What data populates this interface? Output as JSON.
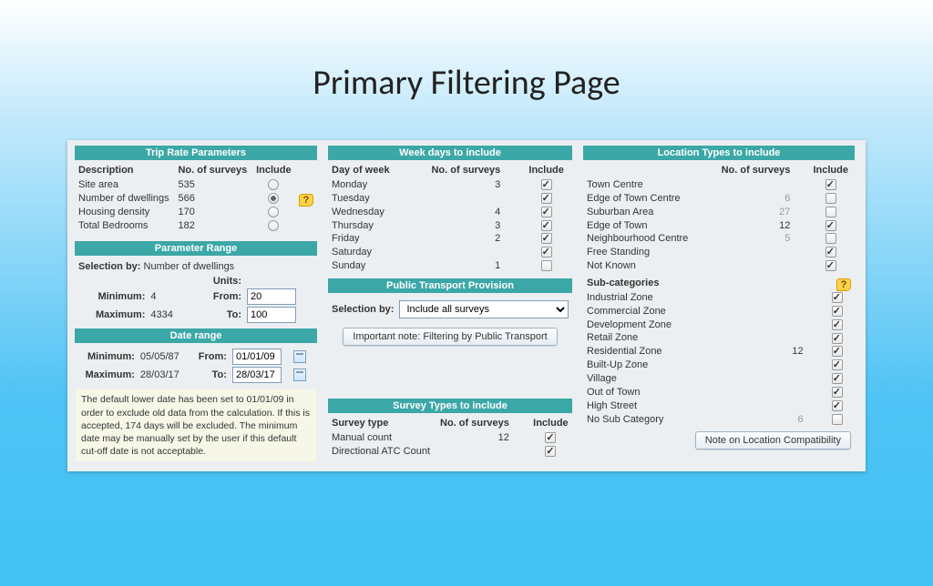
{
  "page_title": "Primary Filtering Page",
  "trip_rate": {
    "header": "Trip Rate Parameters",
    "columns": [
      "Description",
      "No. of surveys",
      "Include"
    ],
    "rows": [
      {
        "desc": "Site area",
        "n": "535",
        "selected": false
      },
      {
        "desc": "Number of dwellings",
        "n": "566",
        "selected": true
      },
      {
        "desc": "Housing density",
        "n": "170",
        "selected": false
      },
      {
        "desc": "Total Bedrooms",
        "n": "182",
        "selected": false
      }
    ]
  },
  "param_range": {
    "header": "Parameter Range",
    "selection_by_label": "Selection by:",
    "selection_by_value": "Number of dwellings",
    "units_label": "Units:",
    "min_label": "Minimum:",
    "min_val": "4",
    "max_label": "Maximum:",
    "max_val": "4334",
    "from_label": "From:",
    "from_val": "20",
    "to_label": "To:",
    "to_val": "100"
  },
  "date_range": {
    "header": "Date range",
    "min_label": "Minimum:",
    "min_val": "05/05/87",
    "max_label": "Maximum:",
    "max_val": "28/03/17",
    "from_label": "From:",
    "from_val": "01/01/09",
    "to_label": "To:",
    "to_val": "28/03/17",
    "note": "The default lower date has been set to 01/01/09 in order to exclude old data from the calculation. If this is accepted, 174 days will be excluded. The minimum date may be manually set by the user if this default cut-off date is not acceptable."
  },
  "week_days": {
    "header": "Week days to include",
    "columns": [
      "Day of week",
      "No. of surveys",
      "Include"
    ],
    "rows": [
      {
        "day": "Monday",
        "n": "3",
        "checked": true
      },
      {
        "day": "Tuesday",
        "n": "",
        "checked": true
      },
      {
        "day": "Wednesday",
        "n": "4",
        "checked": true
      },
      {
        "day": "Thursday",
        "n": "3",
        "checked": true
      },
      {
        "day": "Friday",
        "n": "2",
        "checked": true
      },
      {
        "day": "Saturday",
        "n": "",
        "checked": true
      },
      {
        "day": "Sunday",
        "n": "1",
        "checked": false
      }
    ]
  },
  "public_transport": {
    "header": "Public Transport Provision",
    "selection_by_label": "Selection by:",
    "select_value": "Include all surveys",
    "note_button": "Important note: Filtering by Public Transport"
  },
  "survey_types": {
    "header": "Survey Types to include",
    "columns": [
      "Survey type",
      "No. of surveys",
      "Include"
    ],
    "rows": [
      {
        "type": "Manual count",
        "n": "12",
        "checked": true
      },
      {
        "type": "Directional ATC Count",
        "n": "",
        "checked": true
      }
    ]
  },
  "location_types": {
    "header": "Location Types to include",
    "columns": [
      "",
      "No. of surveys",
      "Include"
    ],
    "rows": [
      {
        "name": "Town Centre",
        "n": "",
        "checked": true
      },
      {
        "name": "Edge of Town Centre",
        "n": "6",
        "checked": false,
        "faded": true
      },
      {
        "name": "Suburban Area",
        "n": "27",
        "checked": false,
        "faded": true
      },
      {
        "name": "Edge of Town",
        "n": "12",
        "checked": true
      },
      {
        "name": "Neighbourhood Centre",
        "n": "5",
        "checked": false,
        "faded": true
      },
      {
        "name": "Free Standing",
        "n": "",
        "checked": true
      },
      {
        "name": "Not Known",
        "n": "",
        "checked": true
      }
    ],
    "sub_header": "Sub-categories",
    "sub_rows": [
      {
        "name": "Industrial Zone",
        "n": "",
        "checked": true
      },
      {
        "name": "Commercial Zone",
        "n": "",
        "checked": true
      },
      {
        "name": "Development Zone",
        "n": "",
        "checked": true
      },
      {
        "name": "Retail Zone",
        "n": "",
        "checked": true
      },
      {
        "name": "Residential Zone",
        "n": "12",
        "checked": true
      },
      {
        "name": "Built-Up Zone",
        "n": "",
        "checked": true
      },
      {
        "name": "Village",
        "n": "",
        "checked": true
      },
      {
        "name": "Out of Town",
        "n": "",
        "checked": true
      },
      {
        "name": "High Street",
        "n": "",
        "checked": true
      },
      {
        "name": "No Sub Category",
        "n": "6",
        "checked": false,
        "faded": true
      }
    ],
    "compat_button": "Note on Location Compatibility"
  }
}
